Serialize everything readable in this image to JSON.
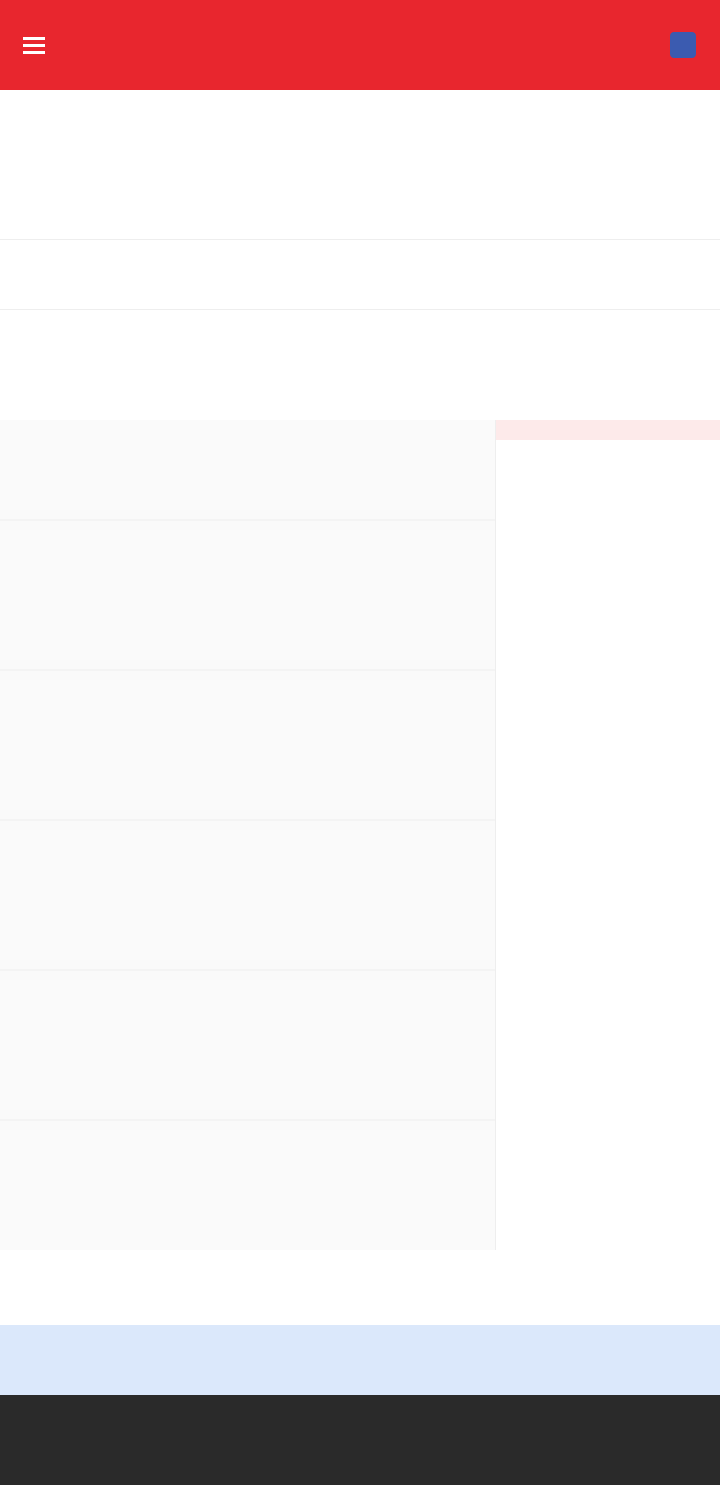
{
  "header": {
    "title": "",
    "subtitle": "",
    "menu_icon": "menu-icon",
    "action_icon": "search-icon"
  },
  "summary": {
    "price": "",
    "change": "",
    "change_pct": "",
    "stats": []
  },
  "tabs": [],
  "periods": [],
  "legend": [],
  "orderbook": {
    "asks": [],
    "bids": []
  },
  "ticks": [],
  "action_buttons": [],
  "banner": {
    "text": "",
    "action": ""
  },
  "nav": [],
  "colors": {
    "brand": "#e8262e",
    "up": "#1fa64a",
    "down": "#e8262e",
    "banner_bg": "#dbe8fb",
    "nav_bg": "#2a2a2a"
  }
}
